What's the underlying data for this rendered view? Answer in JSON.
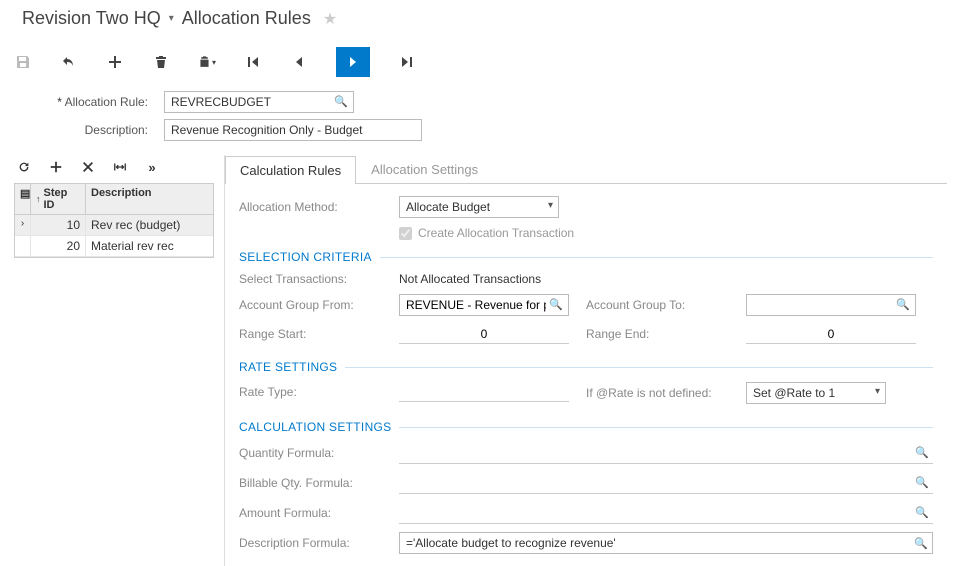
{
  "title_part1": "Revision Two HQ",
  "title_part2": "Allocation Rules",
  "header": {
    "allocation_rule_label": "Allocation Rule:",
    "allocation_rule_value": "REVRECBUDGET",
    "description_label": "Description:",
    "description_value": "Revenue Recognition Only - Budget"
  },
  "grid": {
    "col_step": "Step ID",
    "col_desc": "Description",
    "rows": [
      {
        "step": "10",
        "desc": "Rev rec (budget)",
        "selected": true
      },
      {
        "step": "20",
        "desc": "Material rev rec",
        "selected": false
      }
    ]
  },
  "tabs": {
    "calc": "Calculation Rules",
    "alloc": "Allocation Settings"
  },
  "calc": {
    "allocation_method_label": "Allocation Method:",
    "allocation_method_value": "Allocate Budget",
    "create_alloc_trans": "Create Allocation Transaction",
    "section_selection": "SELECTION CRITERIA",
    "select_trans_label": "Select Transactions:",
    "select_trans_value": "Not Allocated Transactions",
    "acct_from_label": "Account Group From:",
    "acct_from_value": "REVENUE - Revenue for p",
    "acct_to_label": "Account Group To:",
    "acct_to_value": "",
    "range_start_label": "Range Start:",
    "range_start_value": "0",
    "range_end_label": "Range End:",
    "range_end_value": "0",
    "section_rate": "RATE SETTINGS",
    "rate_type_label": "Rate Type:",
    "rate_type_value": "",
    "rate_undef_label": "If @Rate is not defined:",
    "rate_undef_value": "Set @Rate to 1",
    "section_calc": "CALCULATION SETTINGS",
    "qty_formula_label": "Quantity Formula:",
    "qty_formula_value": "",
    "billqty_formula_label": "Billable Qty. Formula:",
    "billqty_formula_value": "",
    "amount_formula_label": "Amount Formula:",
    "amount_formula_value": "",
    "desc_formula_label": "Description Formula:",
    "desc_formula_value": "='Allocate budget to recognize revenue'"
  }
}
